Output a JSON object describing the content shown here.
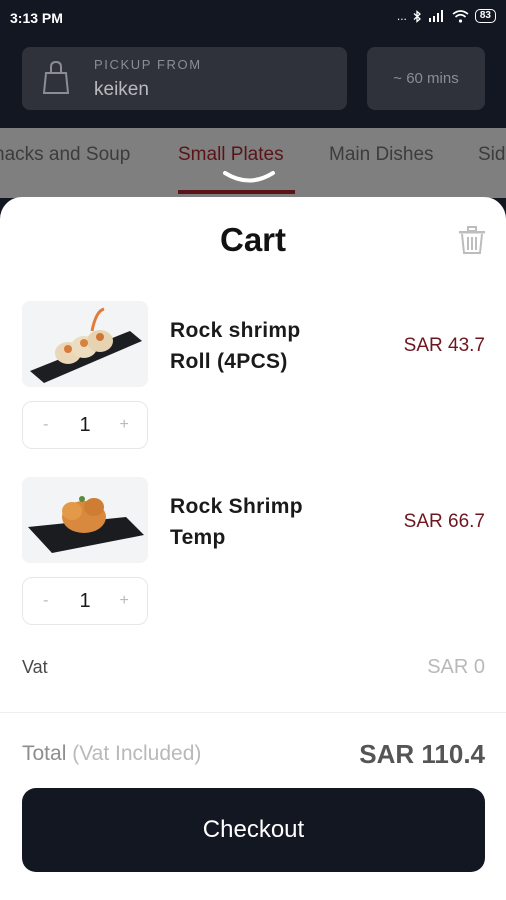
{
  "status_bar": {
    "time": "3:13 PM",
    "dots": "...",
    "battery": "83"
  },
  "header": {
    "pickup_caption": "PICKUP FROM",
    "pickup_value": "keiken",
    "eta": "~ 60 mins"
  },
  "tabs": [
    {
      "label": "nacks and Soup",
      "active": false
    },
    {
      "label": "Small Plates",
      "active": true
    },
    {
      "label": "Main Dishes",
      "active": false
    },
    {
      "label": "Sid",
      "active": false
    }
  ],
  "cart": {
    "title": "Cart",
    "items": [
      {
        "name_line1": "Rock shrimp",
        "name_line2": "Roll (4PCS)",
        "price": "SAR 43.7",
        "qty": "1",
        "minus": "-",
        "plus": "+"
      },
      {
        "name_line1": "Rock Shrimp",
        "name_line2": "Temp",
        "price": "SAR 66.7",
        "qty": "1",
        "minus": "-",
        "plus": "+"
      }
    ],
    "vat_label": "Vat",
    "vat_value": "SAR 0",
    "total_label": "Total",
    "total_note": "(Vat Included)",
    "total_value": "SAR 110.4",
    "checkout_label": "Checkout"
  },
  "colors": {
    "dark": "#131722",
    "accent": "#6d1620",
    "overlay": "#7f7f7f"
  },
  "icons": [
    "shopping-bag-icon",
    "trash-icon",
    "chevron-down-icon",
    "bluetooth-icon",
    "signal-icon",
    "wifi-icon",
    "battery-icon"
  ]
}
